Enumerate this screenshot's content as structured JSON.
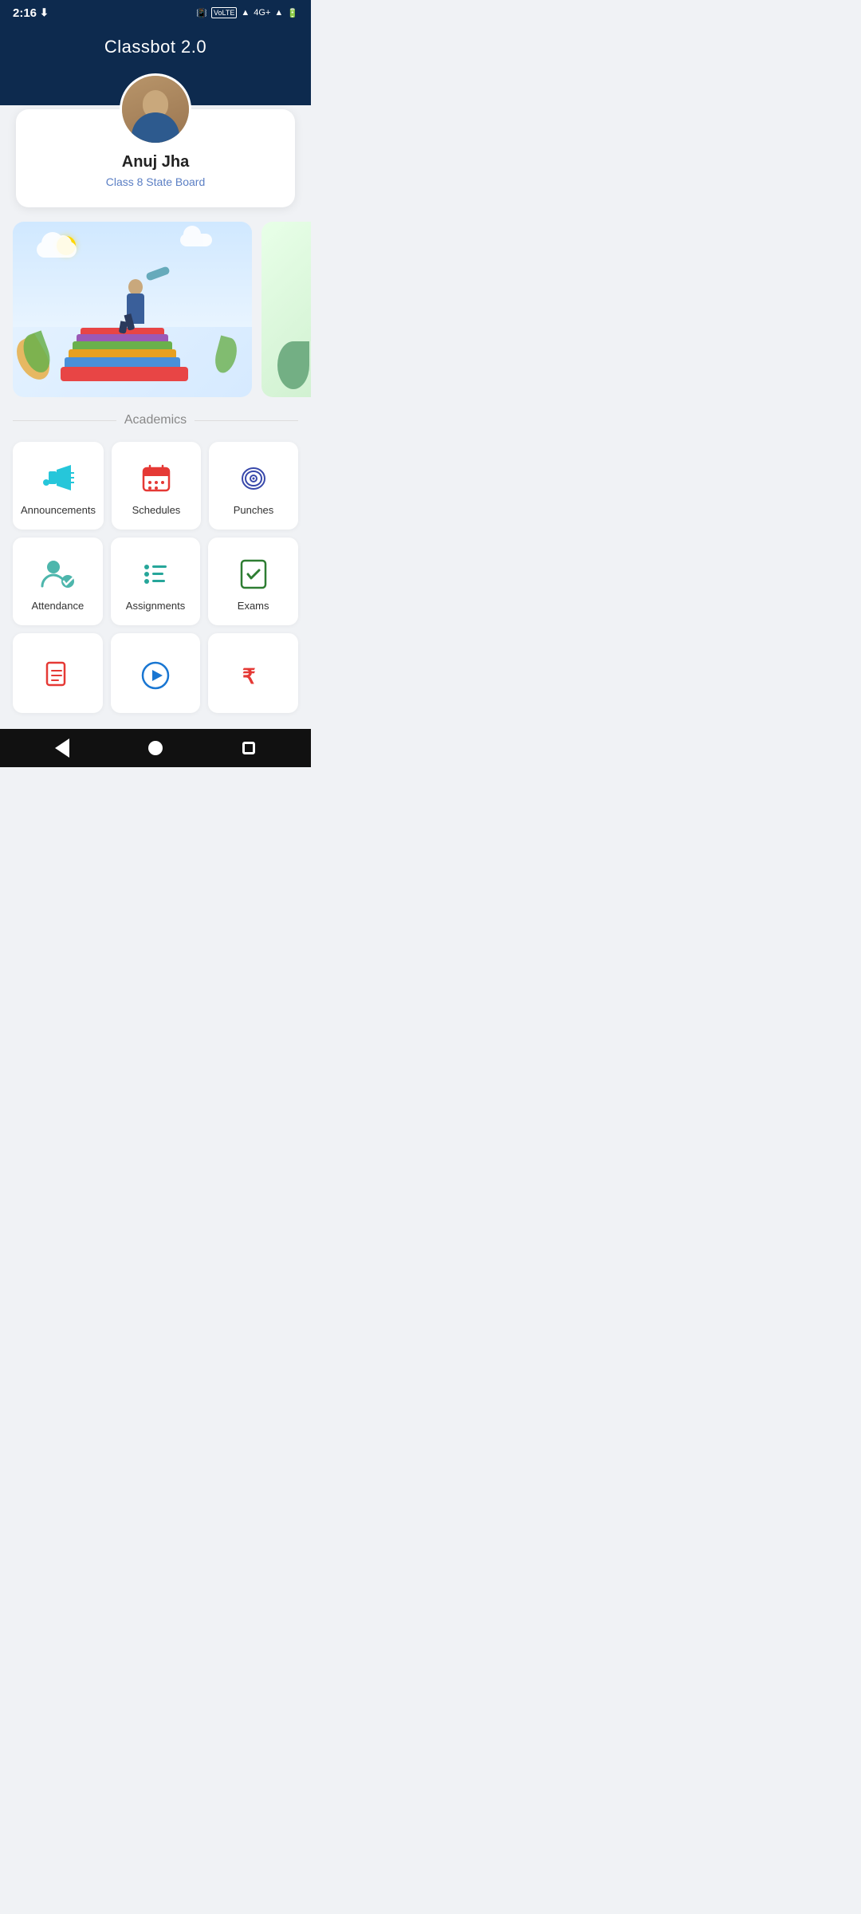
{
  "app": {
    "title": "Classbot 2.0"
  },
  "status_bar": {
    "time": "2:16",
    "network": "4G+",
    "download_icon": "download-icon",
    "vibrate_icon": "vibrate-icon",
    "wifi_icon": "wifi-icon",
    "signal_icon": "signal-icon",
    "battery_icon": "battery-icon"
  },
  "profile": {
    "name": "Anuj Jha",
    "class": "Class 8 State Board"
  },
  "sections": {
    "academics_label": "Academics"
  },
  "grid_items": [
    {
      "id": "announcements",
      "label": "Announcements",
      "icon": "megaphone-icon"
    },
    {
      "id": "schedules",
      "label": "Schedules",
      "icon": "calendar-icon"
    },
    {
      "id": "punches",
      "label": "Punches",
      "icon": "fingerprint-icon"
    },
    {
      "id": "attendance",
      "label": "Attendance",
      "icon": "attendance-icon"
    },
    {
      "id": "assignments",
      "label": "Assignments",
      "icon": "assignments-icon"
    },
    {
      "id": "exams",
      "label": "Exams",
      "icon": "exams-icon"
    }
  ],
  "bottom_items": [
    {
      "id": "documents",
      "label": "",
      "icon": "document-icon"
    },
    {
      "id": "video",
      "label": "",
      "icon": "play-icon"
    },
    {
      "id": "fees",
      "label": "",
      "icon": "rupee-icon"
    }
  ],
  "nav": {
    "back_label": "back",
    "home_label": "home",
    "recent_label": "recent"
  }
}
